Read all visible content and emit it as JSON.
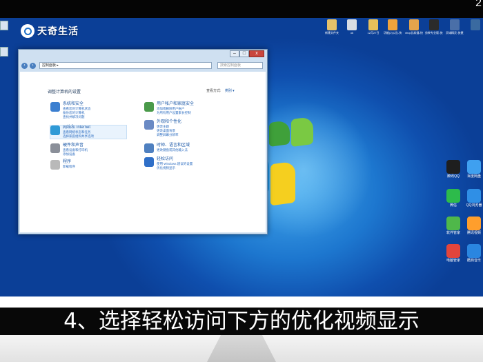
{
  "watermark": {
    "brand": "天奇生活"
  },
  "top_glyph": "2",
  "desktop": {
    "top_icons": [
      {
        "label": "新建文件夹",
        "color": "#e7c26a"
      },
      {
        "label": "ok",
        "color": "#d9dde3"
      },
      {
        "label": "12月27日",
        "color": "#e8c05a"
      },
      {
        "label": "功能(2)公告-快捷方式",
        "color": "#f0a33c"
      },
      {
        "label": "xhop比较器-快捷方式",
        "color": "#e4a44c"
      },
      {
        "label": "剪映专业版-快捷方式",
        "color": "#2b2b2b"
      },
      {
        "label": "灵域精灵-快捷方式",
        "color": "#4a6fa8"
      },
      {
        "label": "",
        "color": "#3a6aa0"
      }
    ],
    "right_icons": [
      {
        "label": "腾讯QQ",
        "color": "#1e1e1e"
      },
      {
        "label": "百度网盘",
        "color": "#3fa0f0"
      },
      {
        "label": "微信",
        "color": "#2dbb4b"
      },
      {
        "label": "QQ浏览器",
        "color": "#2f8fe6"
      },
      {
        "label": "软件管家",
        "color": "#4fb84a"
      },
      {
        "label": "腾讯视频",
        "color": "#ff9e2c"
      },
      {
        "label": "电脑管家",
        "color": "#e2453c"
      },
      {
        "label": "酷狗音乐",
        "color": "#2a86e0"
      }
    ]
  },
  "control_panel": {
    "address": "控制面板 ▸",
    "search_placeholder": "搜索控制面板",
    "heading": "调整计算机的设置",
    "view_by_label": "查看方式:",
    "view_by_value": "类别 ▾",
    "categories_left": [
      {
        "title": "系统和安全",
        "links": [
          "查看您的计算机状态",
          "备份您的计算机",
          "查找并解决问题"
        ],
        "color": "#3b7fd0"
      },
      {
        "title": "网络和 Internet",
        "links": [
          "查看网络状态和任务",
          "选择家庭组和共享选项"
        ],
        "color": "#2f9ad6"
      },
      {
        "title": "硬件和声音",
        "links": [
          "查看设备和打印机",
          "添加设备"
        ],
        "color": "#8a8f99"
      },
      {
        "title": "程序",
        "links": [
          "卸载程序"
        ],
        "color": "#b9b9b9"
      }
    ],
    "categories_right": [
      {
        "title": "用户帐户和家庭安全",
        "links": [
          "添加或删除用户帐户",
          "为所有用户设置家长控制"
        ],
        "color": "#4a9a4a"
      },
      {
        "title": "外观和个性化",
        "links": [
          "更改主题",
          "更改桌面背景",
          "调整屏幕分辨率"
        ],
        "color": "#6a8ac4"
      },
      {
        "title": "时钟、语言和区域",
        "links": [
          "更改键盘或其他输入法"
        ],
        "color": "#4f80c0"
      },
      {
        "title": "轻松访问",
        "links": [
          "使用 Windows 建议的设置",
          "优化视频显示"
        ],
        "color": "#2f6fc8"
      }
    ]
  },
  "taskbar": {
    "icons": [
      "start-orb",
      "explorer",
      "media-player",
      "ie",
      "qq",
      "folder",
      "control-panel"
    ]
  },
  "caption": "4、选择轻松访问下方的优化视频显示"
}
